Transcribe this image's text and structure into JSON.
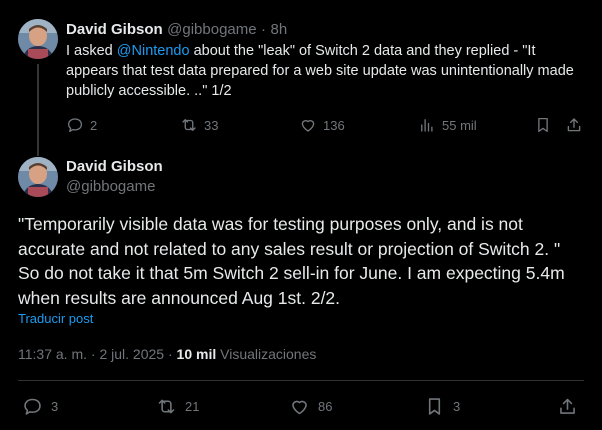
{
  "tweet1": {
    "author_name": "David Gibson",
    "handle": "@gibbogame",
    "separator": "·",
    "time": "8h",
    "text_pre": "I asked ",
    "mention": "@Nintendo",
    "text_post": " about the \"leak\" of Switch 2 data and they replied - \"It appears that test data prepared for a web site update was unintentionally made publicly accessible. ..\" 1/2",
    "actions": {
      "replies": "2",
      "reposts": "33",
      "likes": "136",
      "views": "55 mil"
    }
  },
  "tweet2": {
    "author_name": "David Gibson",
    "handle": "@gibbogame",
    "text": "\"Temporarily visible data was for testing purposes only, and is not accurate and not related to any sales result or projection of Switch 2. \" So do not take it that 5m Switch 2 sell-in for June. I am expecting 5.4m when results are announced Aug 1st.  2/2.",
    "translate_label": "Traducir post",
    "meta": {
      "time": "11:37 a. m.",
      "sep1": "·",
      "date": "2 jul. 2025",
      "sep2": "·",
      "views_count": "10 mil",
      "views_label": "Visualizaciones"
    },
    "actions": {
      "replies": "3",
      "reposts": "21",
      "likes": "86",
      "bookmarks": "3"
    }
  },
  "colors": {
    "background": "#000000",
    "text": "#e7e9ea",
    "muted": "#71767b",
    "link": "#1d9bf0",
    "divider": "#2f3336"
  }
}
